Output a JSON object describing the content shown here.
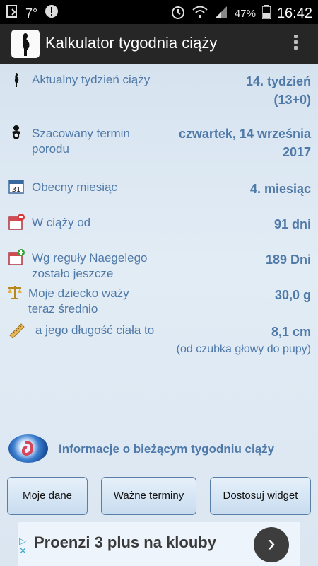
{
  "status_bar": {
    "temperature": "7°",
    "battery": "47%",
    "time": "16:42"
  },
  "app_bar": {
    "title": "Kalkulator tygodnia ciąży"
  },
  "rows": [
    {
      "icon": "pregnant-silhouette-icon",
      "label": "Aktualny tydzień ciąży",
      "value_line1": "14. tydzień",
      "value_line2": "(13+0)"
    },
    {
      "icon": "baby-icon",
      "label_line1": "Szacowany termin",
      "label_line2": "porodu",
      "value_line1": "czwartek, 14 września",
      "value_line2": "2017"
    },
    {
      "icon": "calendar-icon",
      "label": "Obecny miesiąc",
      "value": "4. miesiąc"
    },
    {
      "icon": "calendar-minus-icon",
      "label": "W ciąży od",
      "value": "91 dni"
    },
    {
      "icon": "calendar-plus-icon",
      "label_line1": "Wg reguły Naegelego",
      "label_line2": "zostało jeszcze",
      "value": "189 Dni"
    },
    {
      "icon": "scale-icon",
      "label_line1": "Moje dziecko waży",
      "label_line2": "teraz średnio",
      "value": "30,0 g"
    },
    {
      "icon": "ruler-icon",
      "label": "a jego długość ciała to",
      "value": "8,1 cm",
      "note": "(od czubka głowy do pupy)"
    }
  ],
  "info": {
    "icon": "fetus-icon",
    "label": "Informacje o bieżącym tygodniu ciąży"
  },
  "buttons": {
    "my_data": "Moje dane",
    "important_dates": "Ważne terminy",
    "customize_widget": "Dostosuj widget"
  },
  "ad": {
    "text": "Proenzi 3 plus na klouby",
    "button_icon": "chevron-right-icon"
  }
}
